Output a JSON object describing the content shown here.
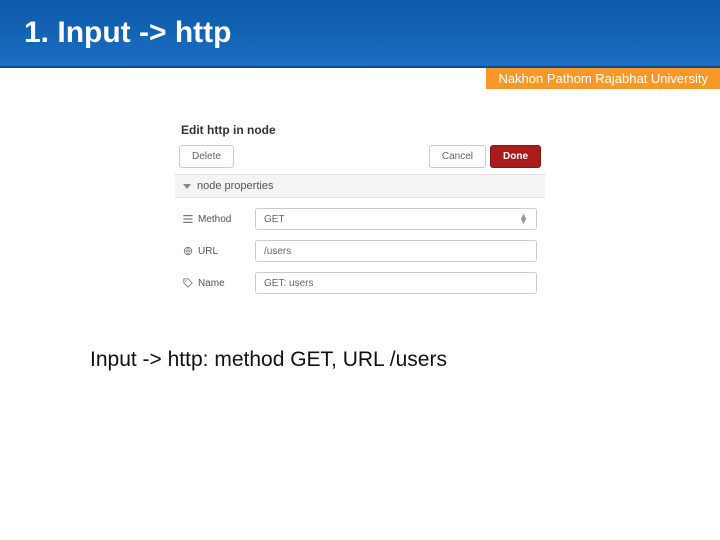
{
  "header": {
    "title": "1. Input -> http",
    "university": "Nakhon Pathom Rajabhat University"
  },
  "panel": {
    "title": "Edit http in node",
    "buttons": {
      "delete": "Delete",
      "cancel": "Cancel",
      "done": "Done"
    },
    "section_label": "node properties",
    "rows": {
      "method": {
        "label": "Method",
        "value": "GET"
      },
      "url": {
        "label": "URL",
        "value": "/users"
      },
      "name": {
        "label": "Name",
        "value": "GET: users"
      }
    }
  },
  "caption": "Input -> http: method GET, URL /users"
}
